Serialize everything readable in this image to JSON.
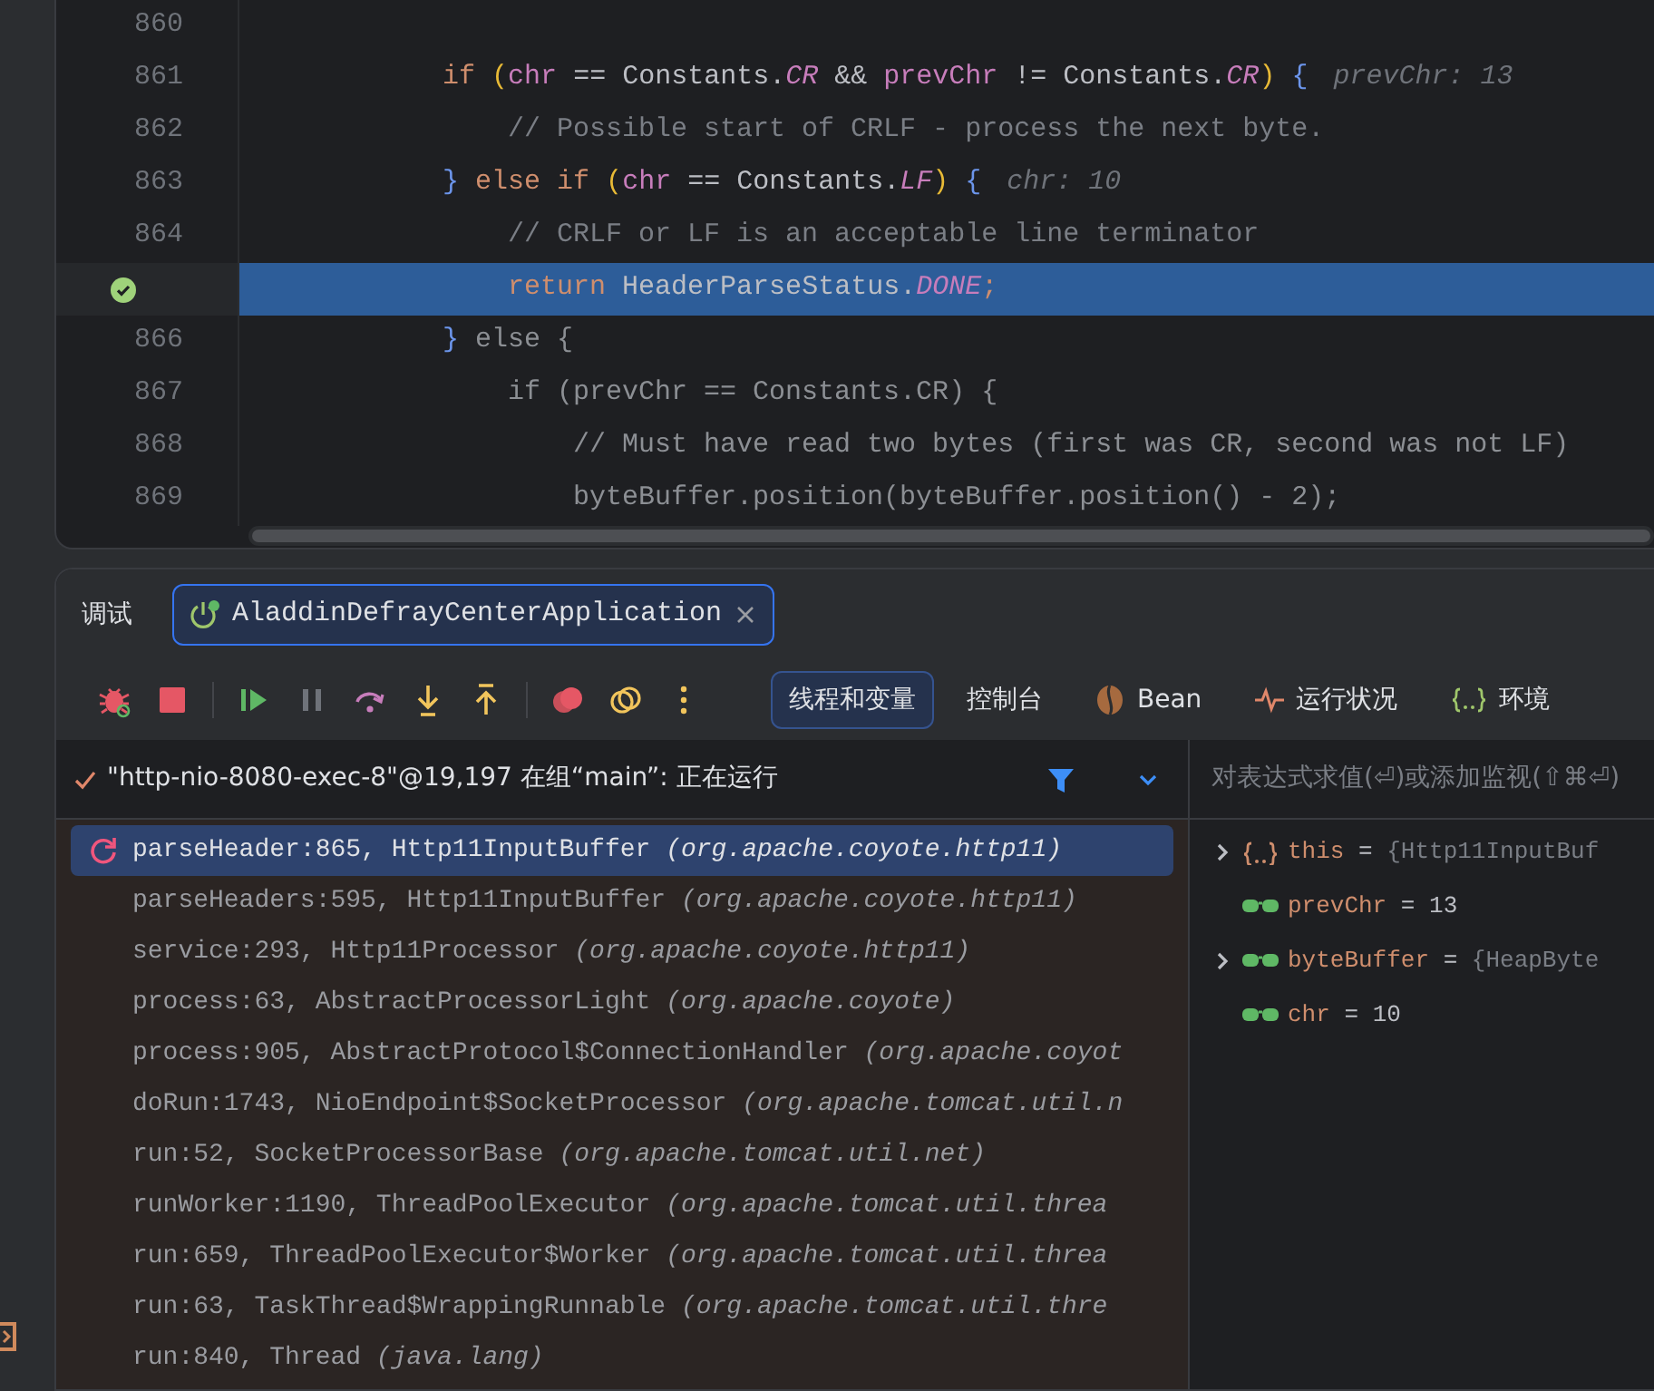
{
  "editor": {
    "lines": [
      {
        "number": "860",
        "current": false
      },
      {
        "number": "861",
        "current": false,
        "tokens": [
          {
            "text": "            if ",
            "kind": "kw"
          },
          {
            "text": "(",
            "kind": "paren"
          },
          {
            "text": "chr",
            "kind": "var"
          },
          {
            "text": " == Constants.",
            "kind": "plain"
          },
          {
            "text": "CR",
            "kind": "konst"
          },
          {
            "text": " && ",
            "kind": "plain"
          },
          {
            "text": "prevChr",
            "kind": "var"
          },
          {
            "text": " != Constants.",
            "kind": "plain"
          },
          {
            "text": "CR",
            "kind": "konst"
          },
          {
            "text": ")",
            "kind": "paren"
          },
          {
            "text": " {",
            "kind": "brace"
          }
        ],
        "hint": "prevChr: 13"
      },
      {
        "number": "862",
        "current": false,
        "tokens": [
          {
            "text": "                // Possible start of CRLF - process the next byte.",
            "kind": "comment"
          }
        ]
      },
      {
        "number": "863",
        "current": false,
        "tokens": [
          {
            "text": "            } ",
            "kind": "brace"
          },
          {
            "text": "else if ",
            "kind": "kw"
          },
          {
            "text": "(",
            "kind": "paren"
          },
          {
            "text": "chr",
            "kind": "var"
          },
          {
            "text": " == Constants.",
            "kind": "plain"
          },
          {
            "text": "LF",
            "kind": "konst"
          },
          {
            "text": ")",
            "kind": "paren"
          },
          {
            "text": " {",
            "kind": "brace"
          }
        ],
        "hint": "chr: 10"
      },
      {
        "number": "864",
        "current": false,
        "tokens": [
          {
            "text": "                // CRLF or LF is an acceptable line terminator",
            "kind": "comment"
          }
        ]
      },
      {
        "current": true,
        "tokens": [
          {
            "text": "                return ",
            "kind": "kw"
          },
          {
            "text": "HeaderParseStatus.",
            "kind": "plain"
          },
          {
            "text": "DONE",
            "kind": "konst"
          },
          {
            "text": ";",
            "kind": "kw"
          }
        ]
      },
      {
        "number": "866",
        "current": false,
        "tokens": [
          {
            "text": "            } ",
            "kind": "brace"
          },
          {
            "text": "else {",
            "kind": "dim"
          }
        ]
      },
      {
        "number": "867",
        "current": false,
        "tokens": [
          {
            "text": "                if (prevChr == Constants.CR) {",
            "kind": "dim"
          }
        ]
      },
      {
        "number": "868",
        "current": false,
        "tokens": [
          {
            "text": "                    // Must have read two bytes (first was CR, second was not LF)",
            "kind": "dim"
          }
        ]
      },
      {
        "number": "869",
        "current": false,
        "tokens": [
          {
            "text": "                    byteBuffer.position(byteBuffer.position() - 2);",
            "kind": "dim"
          }
        ]
      }
    ]
  },
  "debug": {
    "title": "调试",
    "session_tab": {
      "label": "AladdinDefrayCenterApplication",
      "selected": true
    },
    "tabs": [
      {
        "label": "线程和变量",
        "kind": "plain",
        "selected": true
      },
      {
        "label": "控制台",
        "kind": "plain",
        "selected": false
      },
      {
        "label": "Bean",
        "kind": "bean",
        "selected": false
      },
      {
        "label": "运行状况",
        "kind": "health",
        "selected": false
      },
      {
        "label": "环境",
        "kind": "env",
        "selected": false
      }
    ],
    "thread": "\"http-nio-8080-exec-8\"@19,197 在组“main”: 正在运行",
    "evaluate": {
      "placeholder": "对表达式求值(⏎)或添加监视(⇧⌘⏎)"
    },
    "frames": [
      {
        "method": "parseHeader:865, Http11InputBuffer",
        "package": "(org.apache.coyote.http11)",
        "selected": true
      },
      {
        "method": "parseHeaders:595, Http11InputBuffer",
        "package": "(org.apache.coyote.http11)",
        "selected": false
      },
      {
        "method": "service:293, Http11Processor",
        "package": "(org.apache.coyote.http11)",
        "selected": false
      },
      {
        "method": "process:63, AbstractProcessorLight",
        "package": "(org.apache.coyote)",
        "selected": false
      },
      {
        "method": "process:905, AbstractProtocol$ConnectionHandler",
        "package": "(org.apache.coyot",
        "selected": false
      },
      {
        "method": "doRun:1743, NioEndpoint$SocketProcessor",
        "package": "(org.apache.tomcat.util.n",
        "selected": false
      },
      {
        "method": "run:52, SocketProcessorBase",
        "package": "(org.apache.tomcat.util.net)",
        "selected": false
      },
      {
        "method": "runWorker:1190, ThreadPoolExecutor",
        "package": "(org.apache.tomcat.util.threa",
        "selected": false
      },
      {
        "method": "run:659, ThreadPoolExecutor$Worker",
        "package": "(org.apache.tomcat.util.threa",
        "selected": false
      },
      {
        "method": "run:63, TaskThread$WrappingRunnable",
        "package": "(org.apache.tomcat.util.thre",
        "selected": false
      },
      {
        "method": "run:840, Thread",
        "package": "(java.lang)",
        "selected": false
      }
    ],
    "variables": [
      {
        "kind": "object",
        "name": "this",
        "operator": "=",
        "value": "{Http11InputBuf",
        "expanded": false
      },
      {
        "kind": "watch",
        "name": "prevChr",
        "operator": "=",
        "value": "13"
      },
      {
        "kind": "watch",
        "name": "byteBuffer",
        "operator": "=",
        "value": "{HeapByte",
        "expanded": false
      },
      {
        "kind": "watch",
        "name": "chr",
        "operator": "=",
        "value": "10"
      }
    ]
  }
}
